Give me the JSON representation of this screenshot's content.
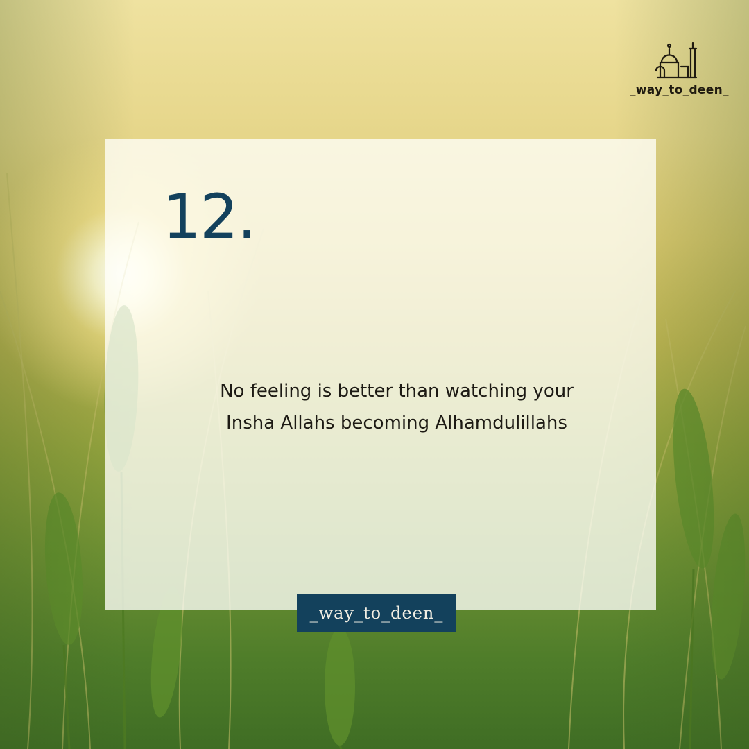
{
  "post": {
    "number": "12.",
    "quote_lines": [
      "No feeling is better than watching your",
      "Insha Allahs becoming Alhamdulillahs"
    ],
    "handle_tag": "_way_to_deen_"
  },
  "logo": {
    "icon": "mosque-icon",
    "text": "_way_to_deen_"
  },
  "colors": {
    "accent": "#13415c",
    "text": "#1d1a14",
    "card": "#fffffa"
  }
}
